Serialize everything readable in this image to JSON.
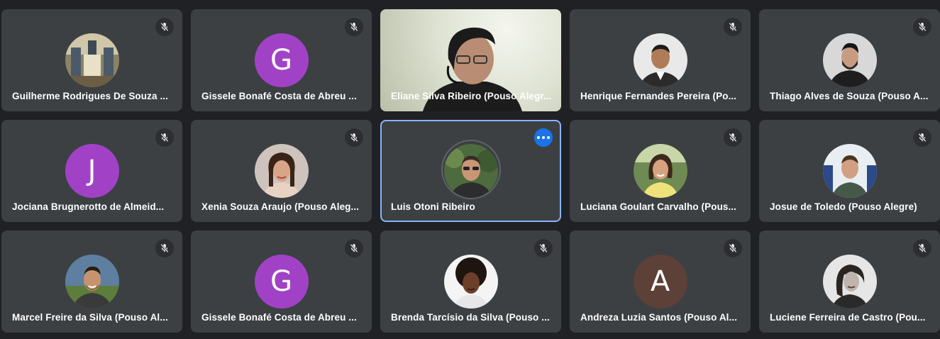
{
  "participants": [
    {
      "name": "Guilherme Rodrigues De Souza ...",
      "avatar": "photo-church-icon",
      "muted": true
    },
    {
      "name": "Gissele Bonafé Costa de Abreu ...",
      "initial": "G",
      "color": "#a142c6",
      "muted": true
    },
    {
      "name": "Eliane Silva Ribeiro (Pouso Alegr...",
      "avatar": "video-feed",
      "muted": false
    },
    {
      "name": "Henrique Fernandes Pereira (Po...",
      "avatar": "photo-person-icon",
      "muted": true
    },
    {
      "name": "Thiago Alves de Souza (Pouso A...",
      "avatar": "photo-person-icon",
      "muted": true
    },
    {
      "name": "Jociana Brugnerotto de Almeid...",
      "initial": "J",
      "color": "#a142c6",
      "muted": true
    },
    {
      "name": "Xenia Souza Araujo (Pouso Aleg...",
      "avatar": "photo-person-icon",
      "muted": true
    },
    {
      "name": "Luis Otoni Ribeiro",
      "avatar": "photo-person-icon",
      "muted": false,
      "active": true
    },
    {
      "name": "Luciana Goulart Carvalho (Pous...",
      "avatar": "photo-person-icon",
      "muted": true
    },
    {
      "name": "Josue de Toledo (Pouso Alegre)",
      "avatar": "photo-person-icon",
      "muted": true
    },
    {
      "name": "Marcel Freire da Silva (Pouso Al...",
      "avatar": "photo-person-icon",
      "muted": true
    },
    {
      "name": "Gissele Bonafé Costa de Abreu ...",
      "initial": "G",
      "color": "#a142c6",
      "muted": true
    },
    {
      "name": "Brenda Tarcísio da Silva (Pouso ...",
      "avatar": "photo-person-icon",
      "muted": true
    },
    {
      "name": "Andreza Luzia Santos (Pouso Al...",
      "initial": "A",
      "color": "#5d4037",
      "muted": true
    },
    {
      "name": "Luciene Ferreira de Castro (Pou...",
      "avatar": "photo-person-icon",
      "muted": true
    }
  ],
  "colors": {
    "background": "#202124",
    "tile": "#3c4043",
    "active_border": "#8ab4f8",
    "more_button": "#1a73e8"
  }
}
